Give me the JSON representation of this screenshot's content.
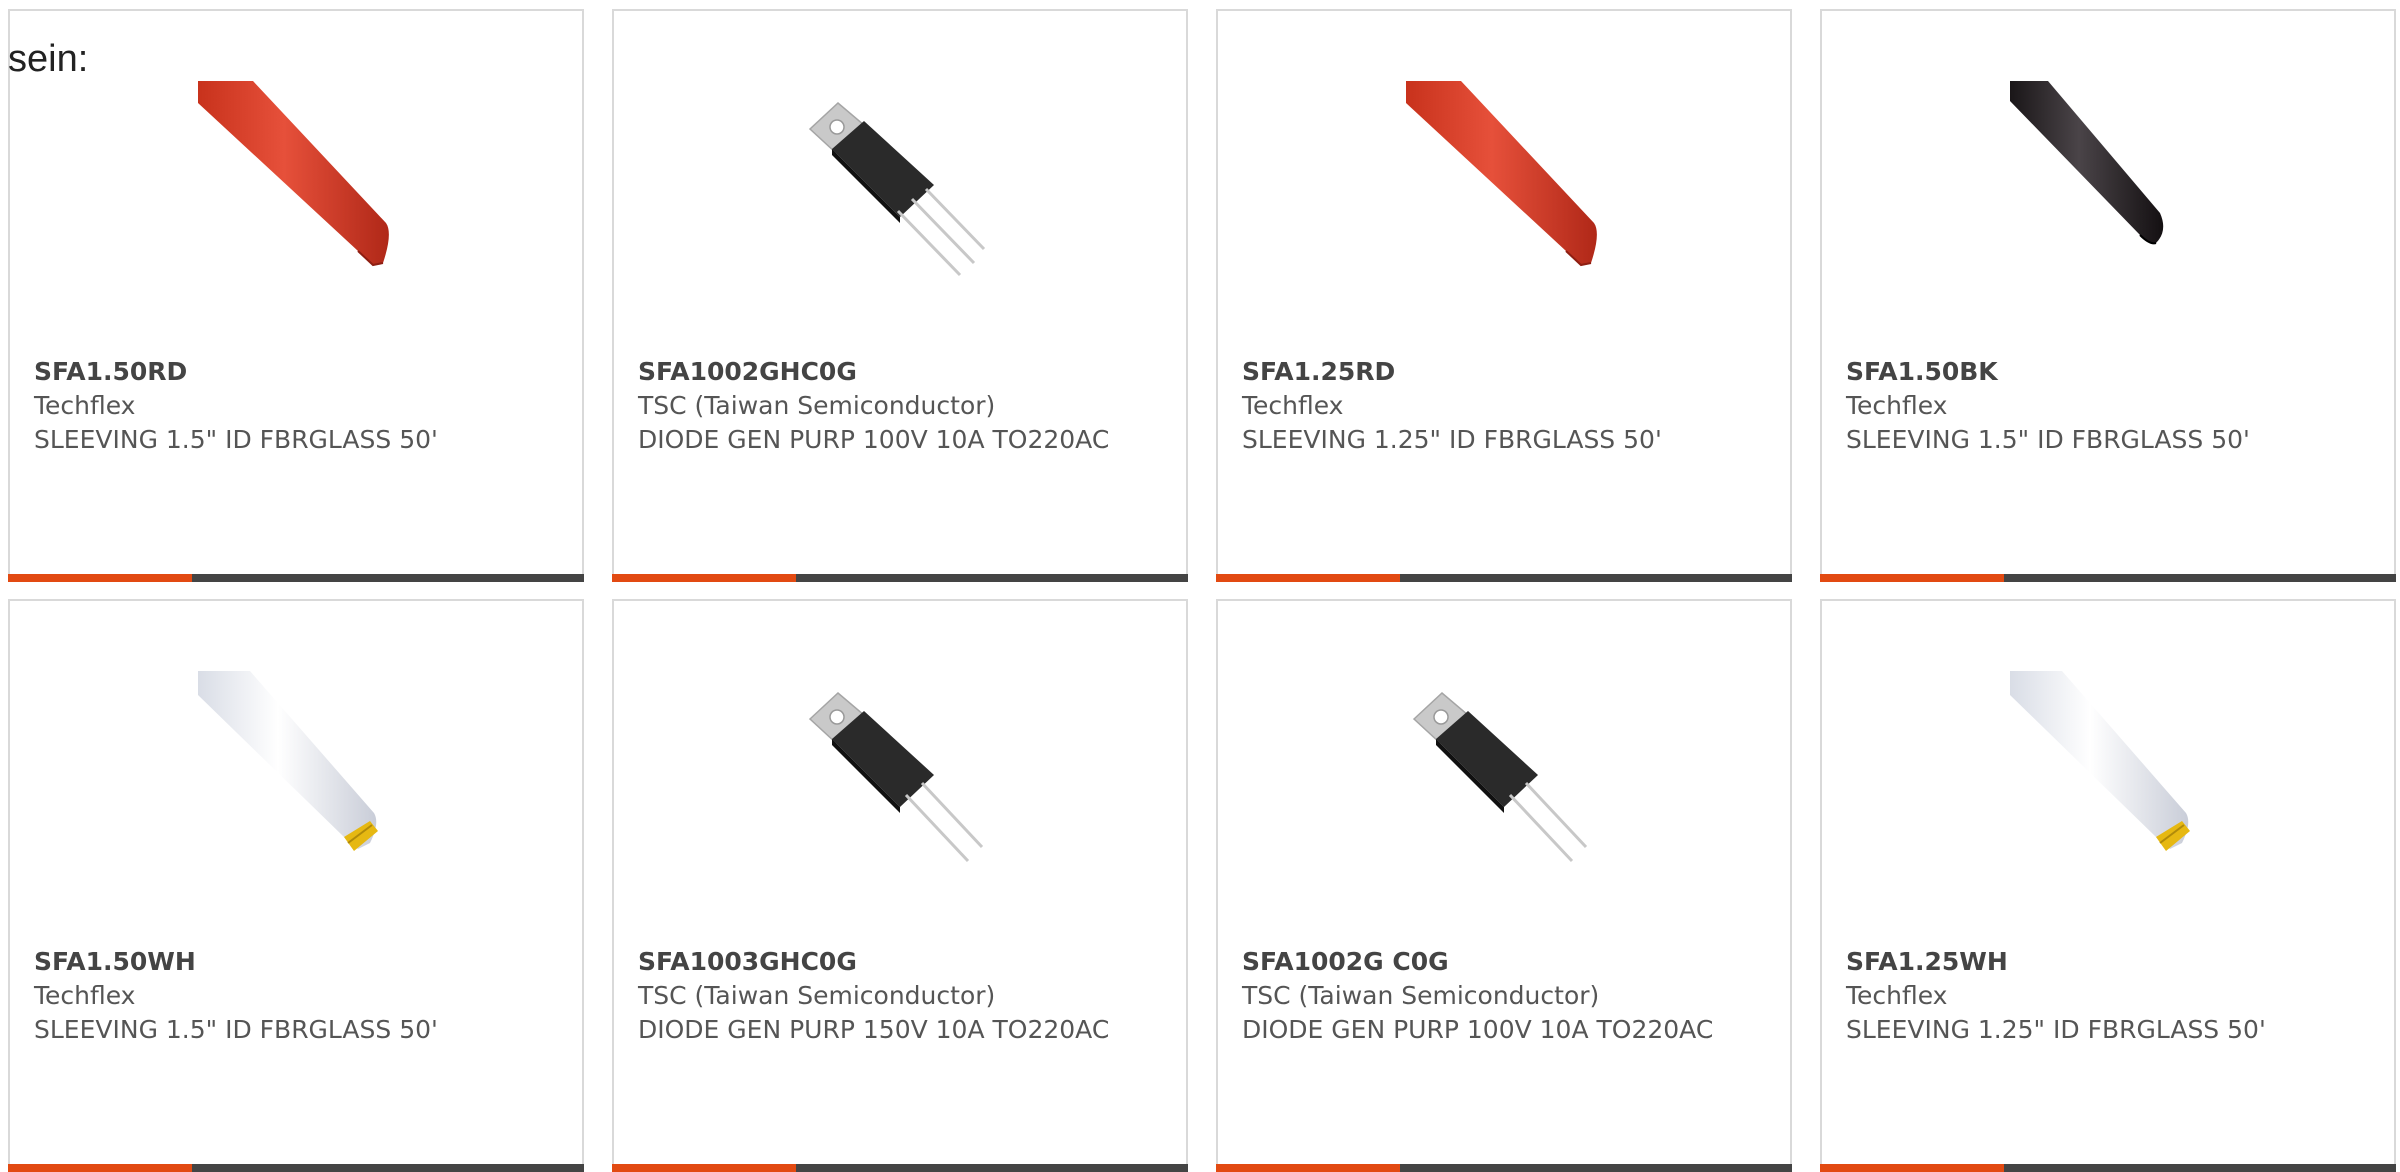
{
  "intro_text": "sein:",
  "colors": {
    "accent": "#e24a12",
    "bar": "#444444",
    "border": "#d9d9d9",
    "text": "#555555"
  },
  "products": [
    {
      "part_number": "SFA1.50RD",
      "manufacturer": "Techflex",
      "description": "SLEEVING 1.5\" ID FBRGLASS 50'",
      "image": "red-sleeving-image"
    },
    {
      "part_number": "SFA1002GHC0G",
      "manufacturer": "TSC (Taiwan Semiconductor)",
      "description": "DIODE GEN PURP 100V 10A TO220AC",
      "image": "to220-diode-image"
    },
    {
      "part_number": "SFA1.25RD",
      "manufacturer": "Techflex",
      "description": "SLEEVING 1.25\" ID FBRGLASS 50'",
      "image": "red-sleeving-image"
    },
    {
      "part_number": "SFA1.50BK",
      "manufacturer": "Techflex",
      "description": "SLEEVING 1.5\" ID FBRGLASS 50'",
      "image": "black-sleeving-image"
    },
    {
      "part_number": "SFA1.50WH",
      "manufacturer": "Techflex",
      "description": "SLEEVING 1.5\" ID FBRGLASS 50'",
      "image": "white-sleeving-image"
    },
    {
      "part_number": "SFA1003GHC0G",
      "manufacturer": "TSC (Taiwan Semiconductor)",
      "description": "DIODE GEN PURP 150V 10A TO220AC",
      "image": "to220-diode-image"
    },
    {
      "part_number": "SFA1002G C0G",
      "manufacturer": "TSC (Taiwan Semiconductor)",
      "description": "DIODE GEN PURP 100V 10A TO220AC",
      "image": "to220-diode-image"
    },
    {
      "part_number": "SFA1.25WH",
      "manufacturer": "Techflex",
      "description": "SLEEVING 1.25\" ID FBRGLASS 50'",
      "image": "white-sleeving-image"
    }
  ]
}
